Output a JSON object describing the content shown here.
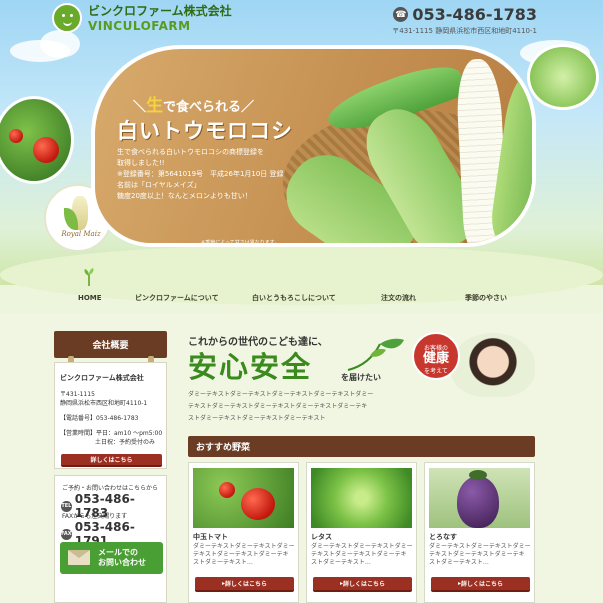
{
  "header": {
    "company_jp": "ビンクロファーム株式会社",
    "company_en": "VINCULOFARM",
    "phone": "053-486-1783",
    "address": "〒431-1115 静岡県浜松市西区和地町4110-1"
  },
  "hero": {
    "lead_accent": "生",
    "lead_rest": "で食べられる",
    "title": "白いトウモロコシ",
    "desc": [
      "生で食べられる白いトウモロコシの商標登録を",
      "取得しました!!",
      "※登録番号：第5641019号　平成26年1月10日 登録",
      "名前は「ロイヤルメイズ」",
      "糖度20度以上！なんとメロンよりも甘い！"
    ],
    "note": "※季節によって甘さは異なります。",
    "badge": "Royal Maiz"
  },
  "nav": {
    "items": [
      "HOME",
      "ビンクロファームについて",
      "白いとうもろこしについて",
      "注文の流れ",
      "季節のやさい"
    ]
  },
  "sidebar": {
    "heading": "会社概要",
    "company": "ビンクロファーム株式会社",
    "zip": "〒431-1115",
    "address": "静岡県浜松市西区和地町4110-1",
    "tel_label": "【電話番号】053-486-1783",
    "hours_label": "【営業時間】平日：am10 〜pm5:00",
    "hours_sat": "土日祝：予約受付のみ",
    "details_button": "詳しくはこちら",
    "contact_note": "ご予約・お問い合わせはこちらから",
    "contact_phone": "053-486-1783",
    "fax_note": "FAXからも注文賜ります",
    "fax_phone": "053-486-1791",
    "tel_badge": "TEL",
    "fax_badge": "FAX",
    "mail_line1": "メールでの",
    "mail_line2": "お問い合わせ"
  },
  "main": {
    "catch_small": "これからの世代のこども達に、",
    "catch_big": "安心安全",
    "catch_tail": "を届けたい",
    "badge_line1": "お客様の",
    "badge_line2": "健康",
    "badge_line3": "を考えて",
    "dummy_lines": [
      "ダミーテキストダミーテキストダミーテキストダミーテキストダミー",
      "テキストダミーテキストダミーテキストダミーテキストダミーテキ",
      "ストダミーテキストダミーテキストダミーテキスト"
    ],
    "section_title": "おすすめ野菜",
    "cards": [
      {
        "title": "中玉トマト",
        "text": [
          "ダミーテキストダミーテキストダミー",
          "テキストダミーテキストダミーテキ",
          "ストダミーテキスト…"
        ],
        "button": "詳しくはこちら"
      },
      {
        "title": "レタス",
        "text": [
          "ダミーテキストダミーテキストダミー",
          "テキストダミーテキストダミーテキ",
          "ストダミーテキスト…"
        ],
        "button": "詳しくはこちら"
      },
      {
        "title": "とろなす",
        "text": [
          "ダミーテキストダミーテキストダミー",
          "テキストダミーテキストダミーテキ",
          "ストダミーテキスト…"
        ],
        "button": "詳しくはこちら"
      }
    ]
  },
  "colors": {
    "brown": "#6a3c23",
    "green": "#3a8a1e",
    "red": "#9b2f22"
  },
  "icons": [
    "phone-icon",
    "sprout-icon",
    "envelope-icon",
    "fax-icon"
  ]
}
